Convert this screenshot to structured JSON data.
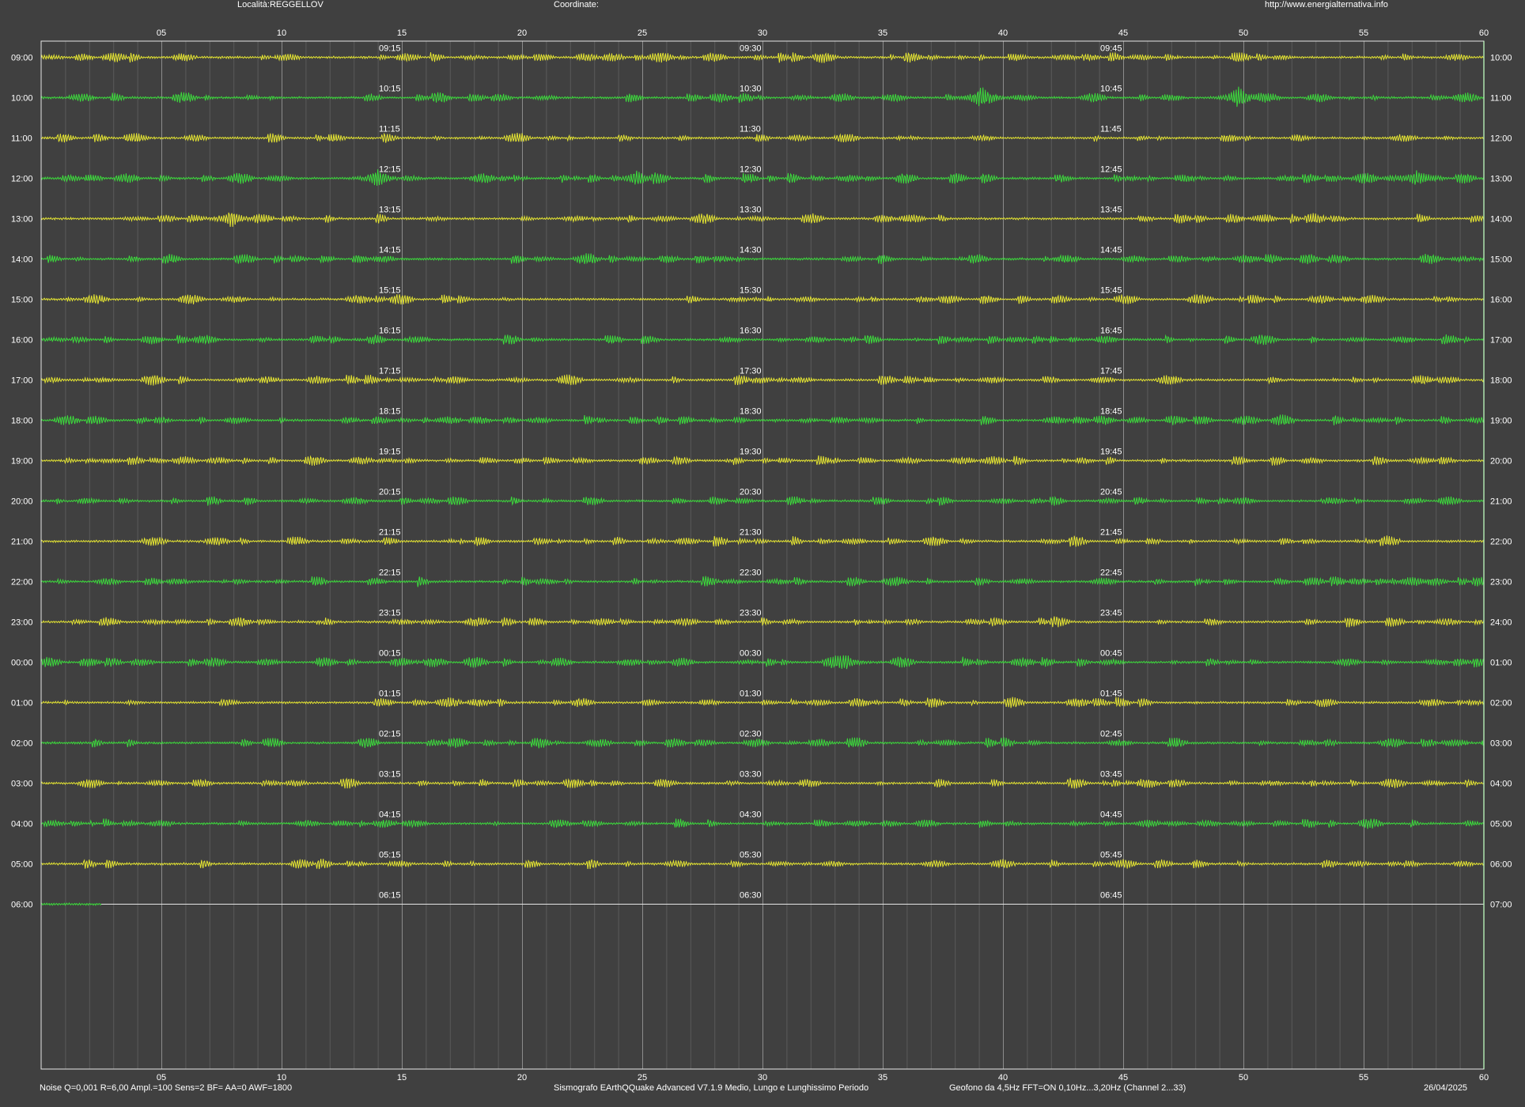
{
  "header": {
    "location": "Località:REGGELLOV",
    "coordinates": "Coordinate:",
    "website": "http://www.energialternativa.info"
  },
  "footer": {
    "settings": "Noise Q=0,001 R=6,00 Ampl.=100 Sens=2 BF= AA=0 AWF=1800",
    "software": "Sismografo  EArthQQuake Advanced V7.1.9  Medio, Lungo e Lunghissimo Periodo",
    "sensor": "Geofono da 4,5Hz FFT=ON 0,10Hz...3,20Hz       (Channel 2...33)",
    "date": "26/04/2025"
  },
  "colors": {
    "background": "#404040",
    "border": "#e6e6e6",
    "grid_minor": "#5a5a5a",
    "grid_major": "#8c8c8c",
    "trace_odd": "#e6e632",
    "trace_even": "#3cdc3c",
    "text": "#ffffff"
  },
  "chart_data": {
    "type": "line",
    "title": "",
    "x_unit": "minutes",
    "x_range": [
      0,
      60
    ],
    "x_ticks": [
      "05",
      "10",
      "15",
      "20",
      "25",
      "30",
      "35",
      "40",
      "45",
      "50",
      "55",
      "60"
    ],
    "rows": [
      {
        "start": "09:00",
        "end": "10:00",
        "marks": [
          "09:15",
          "09:30",
          "09:45"
        ],
        "color": "yellow"
      },
      {
        "start": "10:00",
        "end": "11:00",
        "marks": [
          "10:15",
          "10:30",
          "10:45"
        ],
        "color": "green"
      },
      {
        "start": "11:00",
        "end": "12:00",
        "marks": [
          "11:15",
          "11:30",
          "11:45"
        ],
        "color": "yellow"
      },
      {
        "start": "12:00",
        "end": "13:00",
        "marks": [
          "12:15",
          "12:30",
          "12:45"
        ],
        "color": "green"
      },
      {
        "start": "13:00",
        "end": "14:00",
        "marks": [
          "13:15",
          "13:30",
          "13:45"
        ],
        "color": "yellow"
      },
      {
        "start": "14:00",
        "end": "15:00",
        "marks": [
          "14:15",
          "14:30",
          "14:45"
        ],
        "color": "green"
      },
      {
        "start": "15:00",
        "end": "16:00",
        "marks": [
          "15:15",
          "15:30",
          "15:45"
        ],
        "color": "yellow"
      },
      {
        "start": "16:00",
        "end": "17:00",
        "marks": [
          "16:15",
          "16:30",
          "16:45"
        ],
        "color": "green"
      },
      {
        "start": "17:00",
        "end": "18:00",
        "marks": [
          "17:15",
          "17:30",
          "17:45"
        ],
        "color": "yellow"
      },
      {
        "start": "18:00",
        "end": "19:00",
        "marks": [
          "18:15",
          "18:30",
          "18:45"
        ],
        "color": "green"
      },
      {
        "start": "19:00",
        "end": "20:00",
        "marks": [
          "19:15",
          "19:30",
          "19:45"
        ],
        "color": "yellow"
      },
      {
        "start": "20:00",
        "end": "21:00",
        "marks": [
          "20:15",
          "20:30",
          "20:45"
        ],
        "color": "green"
      },
      {
        "start": "21:00",
        "end": "22:00",
        "marks": [
          "21:15",
          "21:30",
          "21:45"
        ],
        "color": "yellow"
      },
      {
        "start": "22:00",
        "end": "23:00",
        "marks": [
          "22:15",
          "22:30",
          "22:45"
        ],
        "color": "green"
      },
      {
        "start": "23:00",
        "end": "24:00",
        "marks": [
          "23:15",
          "23:30",
          "23:45"
        ],
        "color": "yellow"
      },
      {
        "start": "00:00",
        "end": "01:00",
        "marks": [
          "00:15",
          "00:30",
          "00:45"
        ],
        "color": "green"
      },
      {
        "start": "01:00",
        "end": "02:00",
        "marks": [
          "01:15",
          "01:30",
          "01:45"
        ],
        "color": "yellow"
      },
      {
        "start": "02:00",
        "end": "03:00",
        "marks": [
          "02:15",
          "02:30",
          "02:45"
        ],
        "color": "green"
      },
      {
        "start": "03:00",
        "end": "04:00",
        "marks": [
          "03:15",
          "03:30",
          "03:45"
        ],
        "color": "yellow"
      },
      {
        "start": "04:00",
        "end": "05:00",
        "marks": [
          "04:15",
          "04:30",
          "04:45"
        ],
        "color": "green"
      },
      {
        "start": "05:00",
        "end": "06:00",
        "marks": [
          "05:15",
          "05:30",
          "05:45"
        ],
        "color": "yellow"
      },
      {
        "start": "06:00",
        "end": "07:00",
        "marks": [
          "06:15",
          "06:30",
          "06:45"
        ],
        "color": "green",
        "recorded_until_min": 2.5
      }
    ],
    "events": [
      {
        "row": "10:00",
        "minute": 39.1,
        "amplitude": 1.0
      },
      {
        "row": "10:00",
        "minute": 49.8,
        "amplitude": 1.0
      },
      {
        "row": "12:00",
        "minute": 14.0,
        "amplitude": 0.8
      },
      {
        "row": "12:00",
        "minute": 24.8,
        "amplitude": 0.7
      },
      {
        "row": "12:00",
        "minute": 57.2,
        "amplitude": 0.7
      },
      {
        "row": "13:00",
        "minute": 7.9,
        "amplitude": 0.8
      },
      {
        "row": "00:00",
        "minute": 33.5,
        "amplitude": 0.6
      }
    ]
  }
}
